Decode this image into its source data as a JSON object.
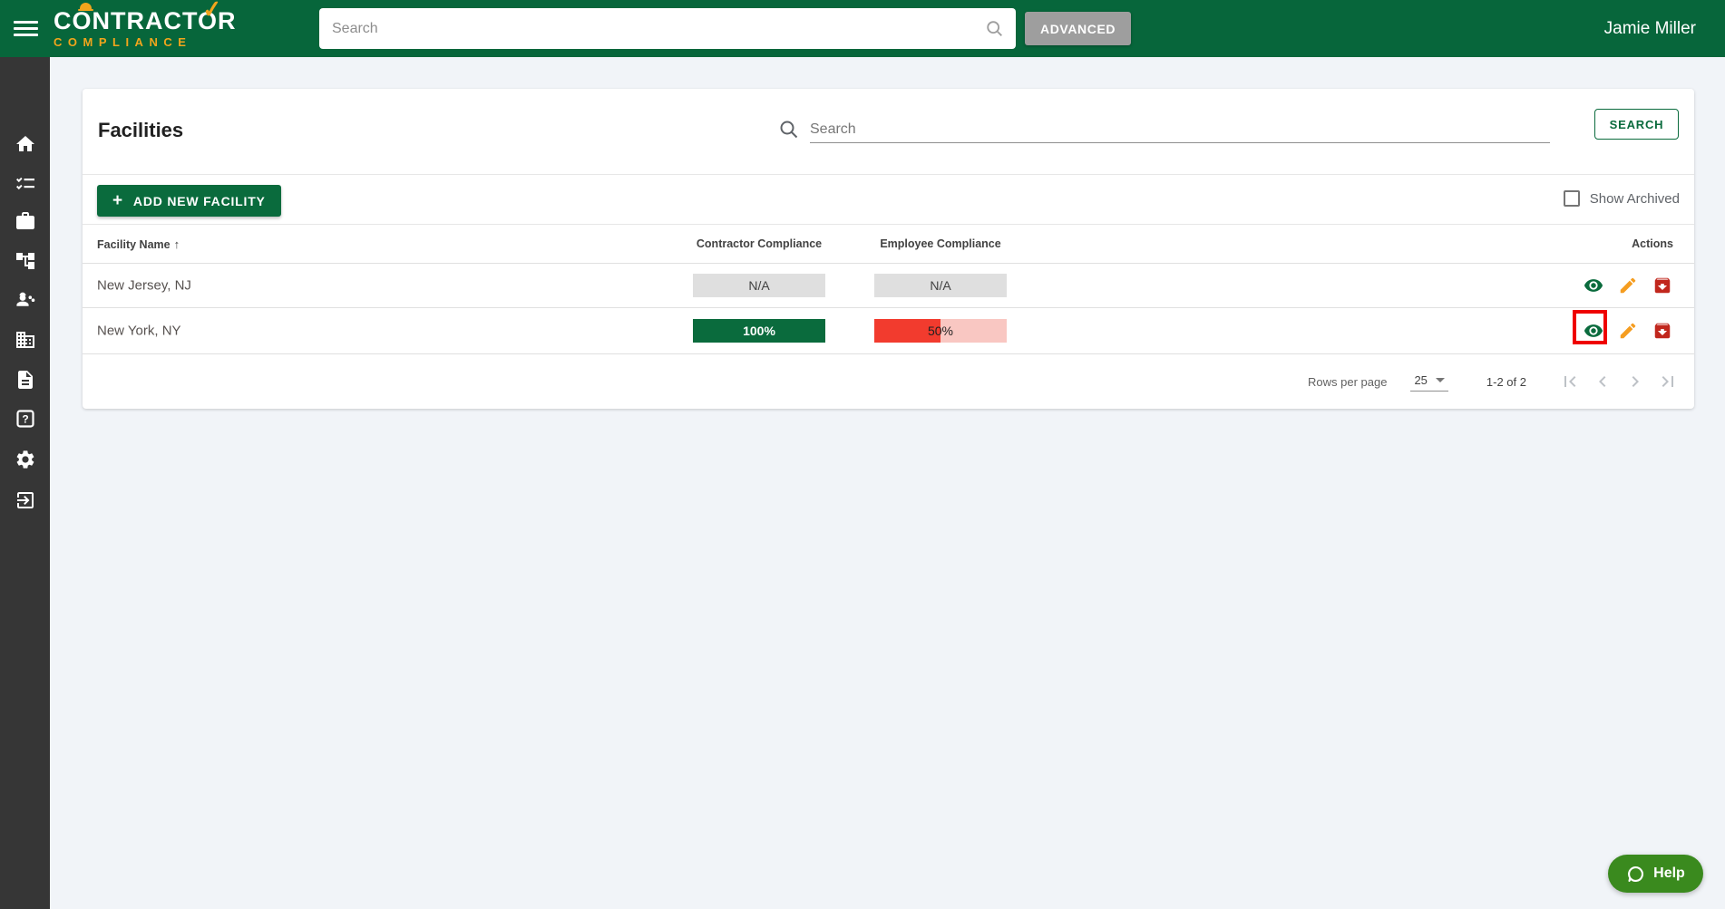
{
  "header": {
    "logo_line1": "CONTRACTOR",
    "logo_line2": "COMPLIANCE",
    "check_glyph": "✓",
    "search_placeholder": "Search",
    "advanced_label": "ADVANCED",
    "user_name": "Jamie Miller"
  },
  "sidebar": {
    "items": [
      {
        "icon": "home-icon"
      },
      {
        "icon": "checklist-icon"
      },
      {
        "icon": "briefcase-icon"
      },
      {
        "icon": "sitemap-icon"
      },
      {
        "icon": "worker-icon"
      },
      {
        "icon": "building-icon"
      },
      {
        "icon": "document-icon"
      },
      {
        "icon": "help-icon"
      },
      {
        "icon": "settings-icon"
      },
      {
        "icon": "logout-icon"
      }
    ]
  },
  "page": {
    "title": "Facilities",
    "search_placeholder": "Search",
    "search_button": "SEARCH",
    "add_button": "ADD NEW FACILITY",
    "add_plus": "+",
    "show_archived": "Show Archived",
    "sort_arrow": "↑"
  },
  "table": {
    "columns": [
      "Facility Name",
      "Contractor Compliance",
      "Employee Compliance",
      "Actions"
    ],
    "rows": [
      {
        "name": "New Jersey, NJ",
        "contractor": "N/A",
        "employee": "N/A"
      },
      {
        "name": "New York, NY",
        "contractor": "100%",
        "contractor_pct": 100,
        "employee": "50%",
        "employee_pct": 50
      }
    ]
  },
  "pagination": {
    "rows_per_page_label": "Rows per page",
    "rows_per_page_value": "25",
    "range": "1-2 of 2"
  },
  "help": {
    "label": "Help"
  },
  "colors": {
    "brand_green": "#07663b",
    "button_green": "#0a6b3d",
    "logo_orange": "#f2a51c",
    "sidebar_gray": "#363636",
    "na_gray": "#dfdfdf",
    "bar_red": "#f23b2e",
    "bar_red_track": "#f9c7c2",
    "archive_red": "#c1271d",
    "pencil_orange": "#f59d20",
    "highlight_red": "#ef0000",
    "help_green": "#3a8a1e"
  }
}
